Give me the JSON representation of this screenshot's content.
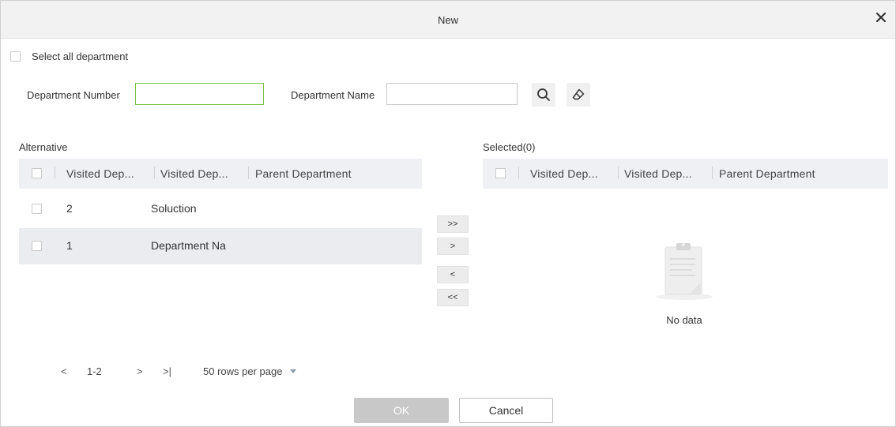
{
  "dialog": {
    "title": "New",
    "close_icon": "close-icon"
  },
  "select_all": {
    "label": "Select all department",
    "checked": false
  },
  "search": {
    "number_label": "Department Number",
    "number_value": "",
    "name_label": "Department Name",
    "name_value": "",
    "search_icon": "search-icon",
    "clear_icon": "eraser-icon"
  },
  "alternative": {
    "title": "Alternative",
    "columns": [
      "Visited Dep...",
      "Visited Dep...",
      "Parent Department"
    ],
    "rows": [
      {
        "number": "2",
        "name": "Soluction",
        "parent": ""
      },
      {
        "number": "1",
        "name": "Department Na",
        "parent": ""
      }
    ]
  },
  "selected": {
    "title": "Selected(0)",
    "columns": [
      "Visited Dep...",
      "Visited Dep...",
      "Parent Department"
    ],
    "empty_text": "No data",
    "empty_icon": "clipboard-icon"
  },
  "transfer": {
    "all_right": ">>",
    "right": ">",
    "left": "<",
    "all_left": "<<"
  },
  "pagination": {
    "prev": "<",
    "range": "1-2",
    "next": ">",
    "last": ">|",
    "rows_per_page": "50 rows per page",
    "dropdown_icon": "caret-down-icon"
  },
  "footer": {
    "ok_label": "OK",
    "cancel_label": "Cancel"
  },
  "colors": {
    "focus_border": "#7ac143",
    "header_bg": "#eef0f4",
    "ok_disabled": "#c8c8c8"
  }
}
